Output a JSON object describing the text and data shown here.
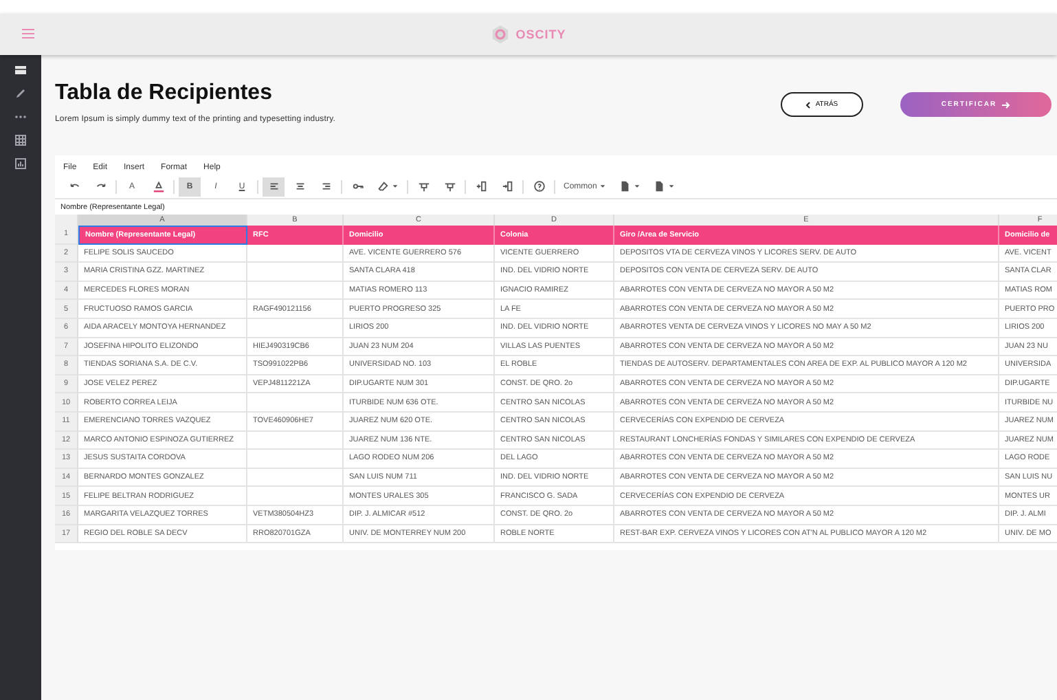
{
  "topbar": {
    "logo": "OSCITY"
  },
  "sidebar": {
    "items": [
      {
        "kind": "rows",
        "selected": true
      },
      {
        "kind": "pencil",
        "selected": false
      },
      {
        "kind": "dots",
        "selected": false
      },
      {
        "kind": "grid",
        "selected": false
      },
      {
        "kind": "chart",
        "selected": false
      }
    ]
  },
  "page": {
    "title": "Tabla de Recipientes",
    "subtitle": "Lorem Ipsum is simply dummy text of the printing and typesetting industry.",
    "back_button": "ATRÁS",
    "certify_button": "CERTIFICAR"
  },
  "menu": [
    "File",
    "Edit",
    "Insert",
    "Format",
    "Help"
  ],
  "toolbar": [
    {
      "kind": "undo"
    },
    {
      "kind": "redo"
    },
    {
      "kind": "sep"
    },
    {
      "kind": "text",
      "label": "A",
      "active": false
    },
    {
      "kind": "fill"
    },
    {
      "kind": "sep"
    },
    {
      "kind": "bold",
      "label": "B",
      "active": true
    },
    {
      "kind": "italic",
      "label": "I",
      "active": false
    },
    {
      "kind": "underline",
      "label": "U",
      "active": false
    },
    {
      "kind": "sep"
    },
    {
      "kind": "align-left",
      "active": true
    },
    {
      "kind": "align-center",
      "active": false
    },
    {
      "kind": "align-right",
      "active": false
    },
    {
      "kind": "sep"
    },
    {
      "kind": "key"
    },
    {
      "kind": "eraser"
    },
    {
      "kind": "sep"
    },
    {
      "kind": "filter"
    },
    {
      "kind": "filter"
    },
    {
      "kind": "sep"
    },
    {
      "kind": "col-left"
    },
    {
      "kind": "col-right"
    },
    {
      "kind": "sep"
    },
    {
      "kind": "help"
    },
    {
      "kind": "sep"
    },
    {
      "kind": "dropdown",
      "label": "Common"
    },
    {
      "kind": "file"
    },
    {
      "kind": "file"
    }
  ],
  "formula_bar": "Nombre  (Representante Legal)",
  "sheet": {
    "columns": [
      "A",
      "B",
      "C",
      "D",
      "E",
      "F"
    ],
    "header_row": {
      "number": "1",
      "cells": [
        {
          "text": "Nombre (Representante Legal)",
          "selected": true
        },
        {
          "text": "RFC",
          "selected": false
        },
        {
          "text": "Domicilio",
          "selected": false
        },
        {
          "text": "Colonia",
          "selected": false
        },
        {
          "text": "Giro /Area de Servicio",
          "selected": false
        },
        {
          "text": "Domicilio de",
          "selected": false
        }
      ]
    },
    "rows": [
      {
        "number": "2",
        "cells": [
          "FELIPE SOLIS SAUCEDO",
          "",
          "AVE. VICENTE GUERRERO 576",
          "VICENTE GUERRERO",
          "DEPOSITOS VTA DE CERVEZA VINOS Y LICORES SERV. DE AUTO",
          "AVE. VICENT"
        ]
      },
      {
        "number": "3",
        "cells": [
          "MARIA CRISTINA GZZ. MARTINEZ",
          "",
          "SANTA CLARA 418",
          "IND. DEL VIDRIO NORTE",
          "DEPOSITOS CON VENTA DE CERVEZA SERV. DE AUTO",
          "SANTA CLAR"
        ]
      },
      {
        "number": "4",
        "cells": [
          "MERCEDES FLORES MORAN",
          "",
          "MATIAS ROMERO 113",
          "IGNACIO RAMIREZ",
          "ABARROTES CON VENTA DE CERVEZA NO MAYOR A 50 M2",
          "MATIAS ROM"
        ]
      },
      {
        "number": "5",
        "cells": [
          "FRUCTUOSO RAMOS GARCIA",
          "RAGF490121156",
          "PUERTO PROGRESO 325",
          "LA FE",
          "ABARROTES CON VENTA DE CERVEZA NO MAYOR A 50 M2",
          "PUERTO PRO"
        ]
      },
      {
        "number": "6",
        "cells": [
          "AIDA ARACELY MONTOYA HERNANDEZ",
          "",
          "LIRIOS 200",
          "IND. DEL VIDRIO NORTE",
          "ABARROTES VENTA DE CERVEZA VINOS Y LICORES NO MAY A 50 M2",
          "LIRIOS 200"
        ]
      },
      {
        "number": "7",
        "cells": [
          "JOSEFINA HIPOLITO ELIZONDO",
          "HIEJ490319CB6",
          "JUAN 23 NUM 204",
          "VILLAS LAS PUENTES",
          "ABARROTES CON VENTA DE CERVEZA NO MAYOR A 50 M2",
          "JUAN 23 NU"
        ]
      },
      {
        "number": "8",
        "cells": [
          "TIENDAS SORIANA S.A. DE C.V.",
          "TSO991022PB6",
          "UNIVERSIDAD NO. 103",
          "EL ROBLE",
          "TIENDAS DE AUTOSERV. DEPARTAMENTALES CON AREA DE EXP. AL PUBLICO MAYOR A 120 M2",
          "UNIVERSIDA"
        ]
      },
      {
        "number": "9",
        "cells": [
          "JOSE VELEZ PEREZ",
          "VEPJ4811221ZA",
          "DIP.UGARTE NUM 301",
          "CONST. DE QRO. 2o",
          "ABARROTES CON VENTA DE CERVEZA NO MAYOR A 50 M2",
          "DIP.UGARTE"
        ]
      },
      {
        "number": "10",
        "cells": [
          "ROBERTO CORREA LEIJA",
          "",
          "ITURBIDE NUM 636 OTE.",
          "CENTRO SAN NICOLAS",
          "ABARROTES CON VENTA DE CERVEZA NO MAYOR A 50 M2",
          "ITURBIDE NU"
        ]
      },
      {
        "number": "11",
        "cells": [
          "EMERENCIANO TORRES VAZQUEZ",
          "TOVE460906HE7",
          "JUAREZ NUM 620 OTE.",
          "CENTRO SAN NICOLAS",
          "CERVECERÍAS CON EXPENDIO DE CERVEZA",
          "JUAREZ NUM"
        ]
      },
      {
        "number": "12",
        "cells": [
          "MARCO ANTONIO ESPINOZA GUTIERREZ",
          "",
          "JUAREZ NUM 136 NTE.",
          "CENTRO SAN NICOLAS",
          "RESTAURANT LONCHERÍAS FONDAS Y SIMILARES CON EXPENDIO DE CERVEZA",
          "JUAREZ NUM"
        ]
      },
      {
        "number": "13",
        "cells": [
          "JESUS SUSTAITA CORDOVA",
          "",
          "LAGO RODEO NUM 206",
          "DEL LAGO",
          "ABARROTES CON VENTA DE CERVEZA NO MAYOR A 50 M2",
          "LAGO RODE"
        ]
      },
      {
        "number": "14",
        "cells": [
          "BERNARDO MONTES GONZALEZ",
          "",
          "SAN LUIS NUM 711",
          "IND. DEL VIDRIO NORTE",
          "ABARROTES CON VENTA DE CERVEZA NO MAYOR A 50 M2",
          "SAN LUIS NU"
        ]
      },
      {
        "number": "15",
        "cells": [
          "FELIPE BELTRAN RODRIGUEZ",
          "",
          "MONTES URALES 305",
          "FRANCISCO G. SADA",
          "CERVECERÍAS CON EXPENDIO DE CERVEZA",
          "MONTES UR"
        ]
      },
      {
        "number": "16",
        "cells": [
          "MARGARITA VELAZQUEZ TORRES",
          "VETM380504HZ3",
          "DIP. J. ALMICAR #512",
          "CONST. DE QRO. 2o",
          "ABARROTES CON VENTA DE CERVEZA NO MAYOR A 50 M2",
          "DIP. J. ALMI"
        ]
      },
      {
        "number": "17",
        "cells": [
          "REGIO DEL ROBLE SA DECV",
          "RRO820701GZA",
          "UNIV. DE MONTERREY NUM 200",
          "ROBLE NORTE",
          "REST-BAR EXP. CERVEZA VINOS Y LICORES CON AT'N AL PUBLICO MAYOR A 120 M2",
          "UNIV. DE MO"
        ]
      }
    ]
  }
}
